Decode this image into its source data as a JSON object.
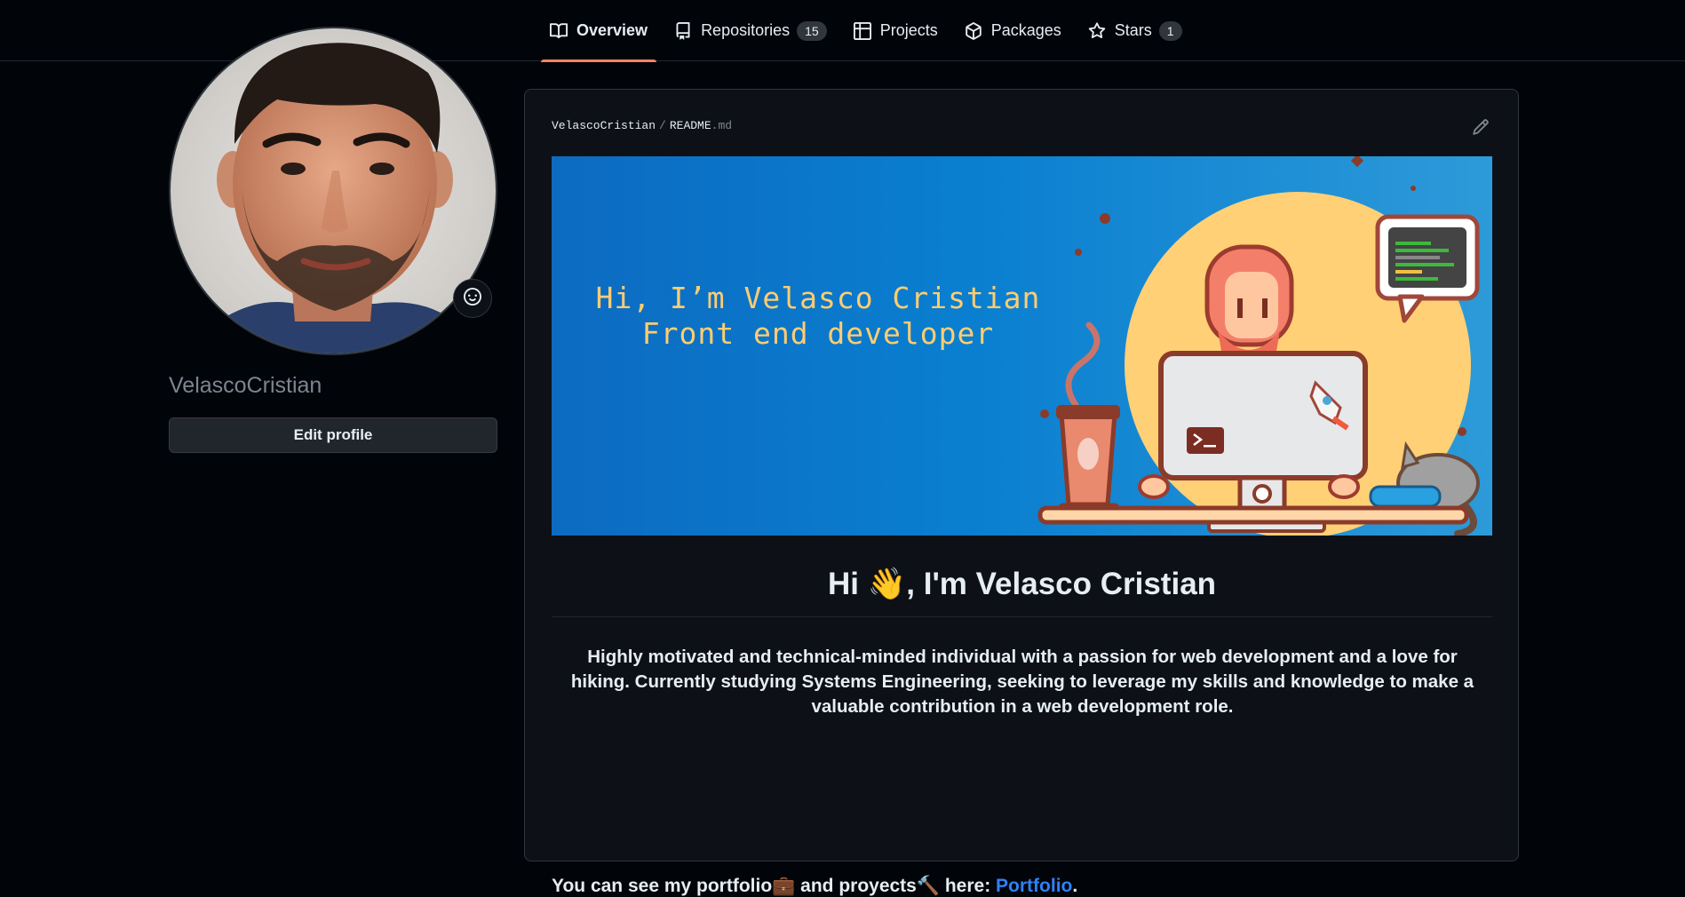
{
  "nav": {
    "tabs": [
      {
        "label": "Overview",
        "icon": "book-icon",
        "active": true
      },
      {
        "label": "Repositories",
        "icon": "repo-icon",
        "count": "15"
      },
      {
        "label": "Projects",
        "icon": "table-icon"
      },
      {
        "label": "Packages",
        "icon": "package-icon"
      },
      {
        "label": "Stars",
        "icon": "star-icon",
        "count": "1"
      }
    ]
  },
  "profile": {
    "username": "VelascoCristian",
    "edit_label": "Edit profile",
    "status_icon": "smiley-icon"
  },
  "readme": {
    "owner": "VelascoCristian",
    "separator": "/",
    "file": "README",
    "ext": ".md",
    "edit_icon": "pencil-icon",
    "banner": {
      "line1": "Hi, I’m Velasco Cristian",
      "line2": "Front end developer"
    },
    "heading_prefix": "Hi ",
    "heading_emoji": "👋",
    "heading_suffix": ", I'm Velasco Cristian",
    "intro": "Highly motivated and technical-minded individual with a passion for web development and a love for hiking. Currently studying Systems Engineering, seeking to leverage my skills and knowledge to make a valuable contribution in a web development role.",
    "portfolio_text1": "You can see my portfolio",
    "portfolio_emoji1": "💼",
    "portfolio_text2": " and proyects",
    "portfolio_emoji2": "🔨",
    "portfolio_text3": " here: ",
    "portfolio_link": "Portfolio",
    "portfolio_end": "."
  },
  "colors": {
    "background": "#010409",
    "card": "#0d1117",
    "accent_tab": "#f78166",
    "link": "#2f81f7",
    "banner_text": "#ffcd70"
  }
}
